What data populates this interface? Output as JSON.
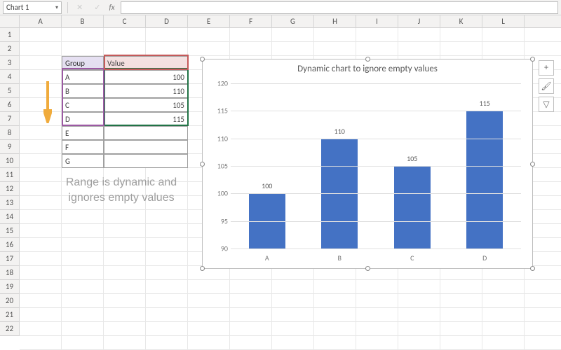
{
  "name_box": "Chart 1",
  "cancel_glyph": "✕",
  "accept_glyph": "✓",
  "fx_label": "fx",
  "columns": [
    "",
    "A",
    "B",
    "C",
    "D",
    "E",
    "F",
    "G",
    "H",
    "I",
    "J",
    "K",
    "L"
  ],
  "rows": [
    "1",
    "2",
    "3",
    "4",
    "5",
    "6",
    "7",
    "8",
    "9",
    "10",
    "11",
    "12",
    "13",
    "14",
    "15",
    "16",
    "17",
    "18",
    "19",
    "20",
    "21",
    "22"
  ],
  "table": {
    "header_group": "Group",
    "header_value": "Value",
    "rows": [
      {
        "group": "A",
        "value": "100"
      },
      {
        "group": "B",
        "value": "110"
      },
      {
        "group": "C",
        "value": "105"
      },
      {
        "group": "D",
        "value": "115"
      },
      {
        "group": "E",
        "value": ""
      },
      {
        "group": "F",
        "value": ""
      },
      {
        "group": "G",
        "value": ""
      }
    ]
  },
  "annotation": "Range is dynamic and ignores empty values",
  "chart_data": {
    "type": "bar",
    "title": "Dynamic chart to ignore empty values",
    "categories": [
      "A",
      "B",
      "C",
      "D"
    ],
    "values": [
      100,
      110,
      105,
      115
    ],
    "labels": [
      "100",
      "110",
      "105",
      "115"
    ],
    "ylim": [
      90,
      120
    ],
    "yticks": [
      90,
      95,
      100,
      105,
      110,
      115,
      120
    ]
  },
  "chart_buttons": {
    "plus": "+",
    "brush": "🖌",
    "filter": "▽"
  }
}
